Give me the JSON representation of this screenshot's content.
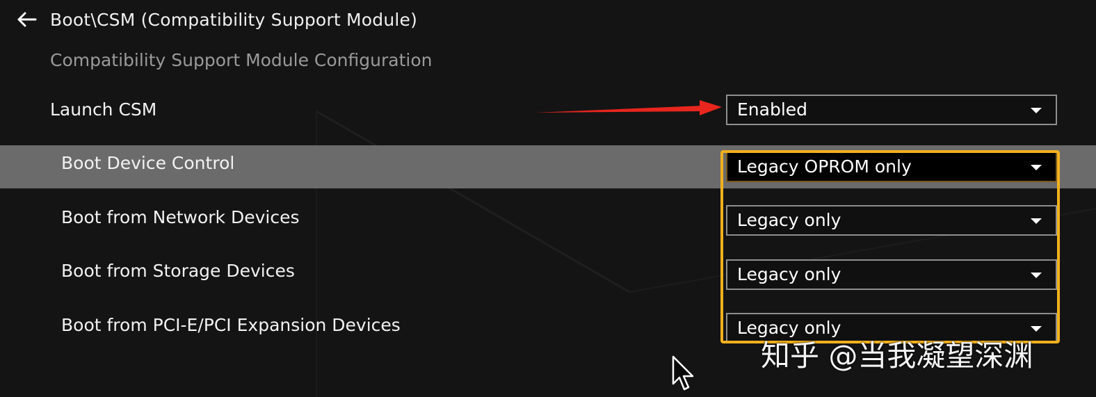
{
  "header": {
    "back_icon": "arrow-left-icon",
    "breadcrumb": "Boot\\CSM (Compatibility Support Module)"
  },
  "section_title": "Compatibility Support Module Configuration",
  "settings": [
    {
      "label": "Launch CSM",
      "value": "Enabled"
    },
    {
      "label": "Boot Device Control",
      "value": "Legacy OPROM only"
    },
    {
      "label": "Boot from Network Devices",
      "value": "Legacy only"
    },
    {
      "label": "Boot from Storage Devices",
      "value": "Legacy only"
    },
    {
      "label": "Boot from PCI-E/PCI Expansion Devices",
      "value": "Legacy only"
    }
  ],
  "annotations": {
    "arrow_color": "#e8261e",
    "highlight_color": "#f2b01e"
  },
  "watermark": "知乎 @当我凝望深渊",
  "colors": {
    "background": "#141414",
    "selected_row": "#6b6b6b",
    "dropdown_border": "#8f8f8f"
  }
}
